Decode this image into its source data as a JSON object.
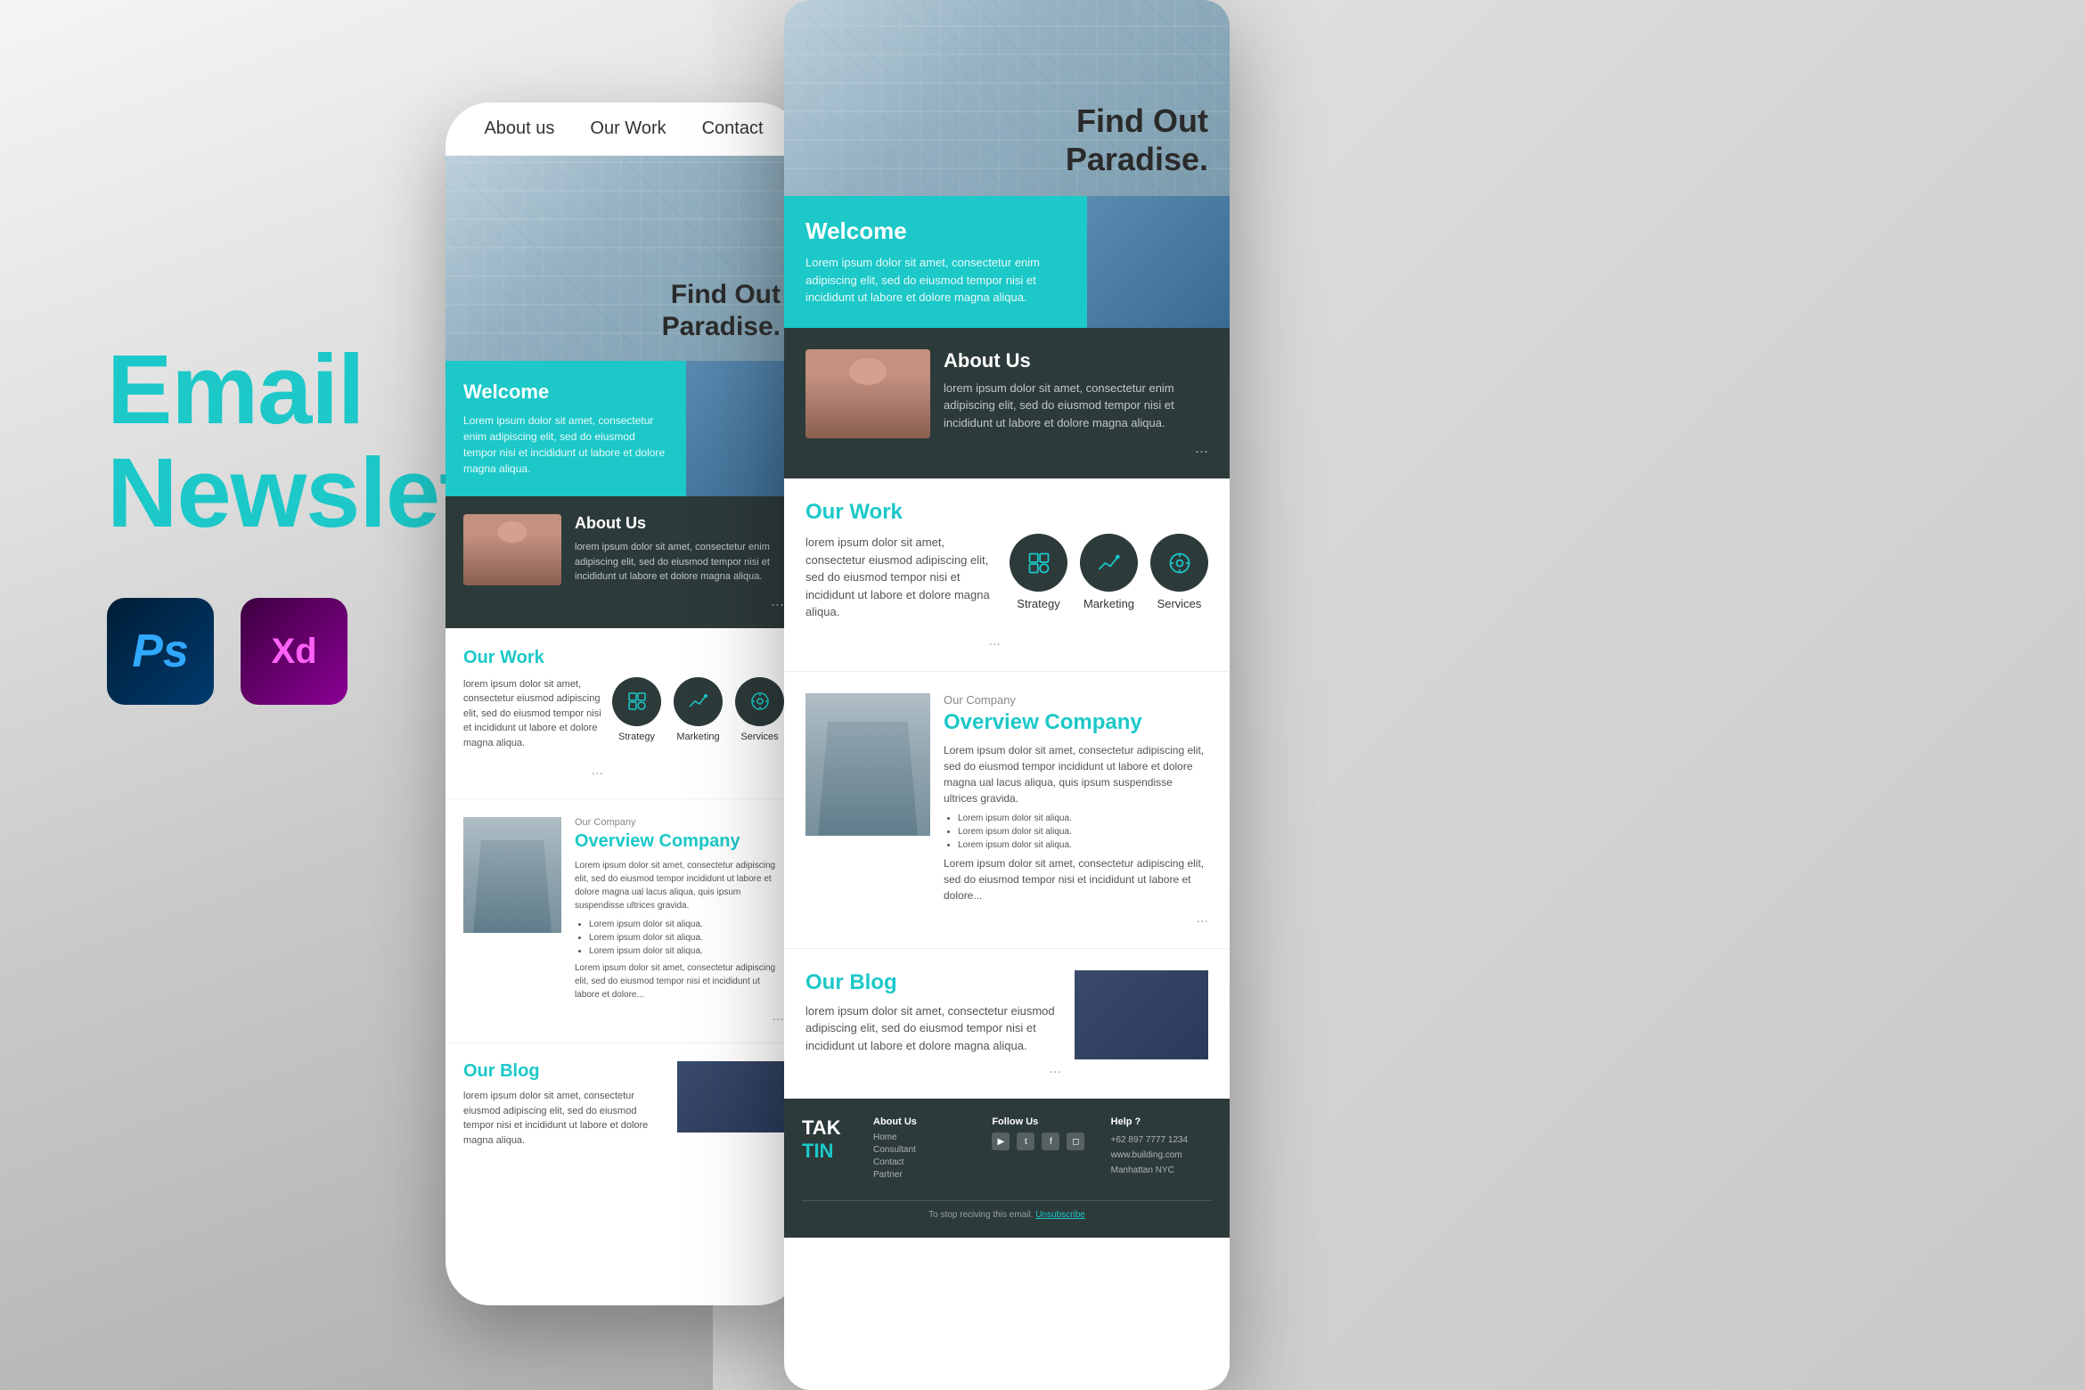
{
  "page": {
    "background": "#e0e0e0",
    "title": "Email Newsletter"
  },
  "left": {
    "title_line1": "Email",
    "title_line2": "Newsletter",
    "ps_label": "Ps",
    "xd_label": "Xd"
  },
  "phone1": {
    "nav": {
      "items": [
        "About us",
        "Our Work",
        "Contact"
      ]
    },
    "hero": {
      "title": "Find Out\nParadise."
    },
    "welcome": {
      "title": "Welcome",
      "body": "Lorem ipsum dolor sit amet, consectetur enim adipiscing elit, sed do eiusmod tempor nisi et incididunt ut labore et dolore magna aliqua."
    },
    "about": {
      "title": "About Us",
      "body": "lorem ipsum dolor sit amet, consectetur enim adipiscing elit, sed do eiusmod tempor nisi et incididunt ut labore et dolore magna aliqua.",
      "dots": "..."
    },
    "our_work": {
      "title": "Our Work",
      "body": "lorem ipsum dolor sit amet, consectetur eiusmod adipiscing elit, sed do eiusmod tempor nisi et incididunt ut labore et dolore magna aliqua.",
      "icons": [
        {
          "label": "Strategy"
        },
        {
          "label": "Marketing"
        },
        {
          "label": "Services"
        }
      ],
      "dots": "..."
    },
    "company": {
      "label": "Our Company",
      "title": "Overview Company",
      "body": "Lorem ipsum dolor sit amet, consectetur adipiscing elit, sed do eiusmod tempor incididunt ut labore et dolore magna ual lacus aliqua, quis ipsum suspendisse ultrices gravida.",
      "list": [
        "Lorem ipsum dolor sit aliqua.",
        "Lorem ipsum dolor sit aliqua.",
        "Lorem ipsum dolor sit aliqua."
      ],
      "body2": "Lorem ipsum dolor sit amet, consectetur adipiscing elit, sed do eiusmod tempor nisi et incididunt ut labore et dolore..."
    },
    "blog": {
      "title": "Our Blog",
      "body": "lorem ipsum dolor sit amet, consectetur eiusmod adipiscing elit, sed do eiusmod tempor nisi et incididunt ut labore et dolore magna aliqua."
    },
    "footer": {
      "logo": "TAK\nTIN",
      "cols": [
        {
          "title": "About Us",
          "links": [
            "Home",
            "Consultant",
            "Contact",
            "Partner"
          ]
        },
        {
          "title": "Follow Us",
          "social": [
            "▶",
            "t",
            "f",
            "◻"
          ]
        },
        {
          "title": "Help ?",
          "info": [
            "+62 897 7777 1234",
            "www.building.com",
            "Manhattan NYC"
          ]
        }
      ],
      "unsubscribe": "To stop reciving this email. Unsubscribe"
    }
  },
  "phone2": {
    "hero": {
      "title": "Find Out\nParadise."
    },
    "welcome": {
      "title": "Welcome",
      "body": "Lorem ipsum dolor sit amet, consectetur enim adipiscing elit, sed do eiusmod tempor nisi et incididunt ut labore et dolore magna aliqua."
    },
    "about": {
      "title": "About Us",
      "body": "lorem ipsum dolor sit amet, consectetur enim adipiscing elit, sed do eiusmod tempor nisi et incididunt ut labore et dolore magna aliqua."
    },
    "our_work": {
      "title": "Our Work",
      "body": "lorem ipsum dolor sit amet, consectetur eiusmod adipiscing elit, sed do eiusmod tempor nisi et incididunt ut labore et dolore magna aliqua.",
      "icons": [
        {
          "label": "Strategy"
        },
        {
          "label": "Marketing"
        },
        {
          "label": "Services"
        }
      ]
    },
    "company": {
      "label": "Our Company",
      "title": "Overview Company",
      "body": "Lorem ipsum dolor sit amet, consectetur adipiscing elit, sed do eiusmod tempor incididunt ut labore et dolore magna ual lacus aliqua, quis ipsum suspendisse ultrices gravida.",
      "list": [
        "Lorem ipsum dolor sit aliqua.",
        "Lorem ipsum dolor sit aliqua.",
        "Lorem ipsum dolor sit aliqua."
      ],
      "body2": "Lorem ipsum dolor sit amet, consectetur adipiscing elit, sed do eiusmod tempor nisi et incididunt ut labore et dolore..."
    },
    "blog": {
      "title": "Our Blog",
      "body": "lorem ipsum dolor sit amet, consectetur eiusmod adipiscing elit, sed do eiusmod tempor nisi et incididunt ut labore et dolore magna aliqua."
    },
    "footer": {
      "logo": "TAK\nTIN",
      "unsubscribe": "To stop reciving this email. Unsubscribe"
    }
  }
}
